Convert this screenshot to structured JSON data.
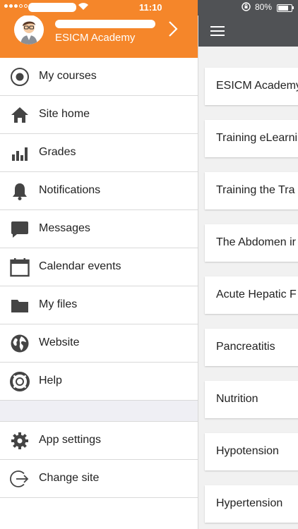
{
  "status": {
    "time": "11:10",
    "battery": "80%",
    "battery_level": 0.8
  },
  "drawer": {
    "site_name": "ESICM Academy",
    "items": [
      {
        "label": "My courses"
      },
      {
        "label": "Site home"
      },
      {
        "label": "Grades"
      },
      {
        "label": "Notifications"
      },
      {
        "label": "Messages"
      },
      {
        "label": "Calendar events"
      },
      {
        "label": "My files"
      },
      {
        "label": "Website"
      },
      {
        "label": "Help"
      }
    ],
    "bottom_items": [
      {
        "label": "App settings"
      },
      {
        "label": "Change site"
      }
    ]
  },
  "courses": [
    {
      "label": "ESICM Academy"
    },
    {
      "label": "Training eLearni"
    },
    {
      "label": "Training the Tra"
    },
    {
      "label": "The Abdomen ir"
    },
    {
      "label": "Acute Hepatic F"
    },
    {
      "label": "Pancreatitis"
    },
    {
      "label": "Nutrition"
    },
    {
      "label": "Hypotension"
    },
    {
      "label": "Hypertension"
    }
  ],
  "icons": {
    "my_courses": "target-icon",
    "site_home": "home-icon",
    "grades": "bar-chart-icon",
    "notifications": "bell-icon",
    "messages": "chat-bubble-icon",
    "calendar": "calendar-icon",
    "files": "folder-icon",
    "website": "globe-icon",
    "help": "lifebuoy-icon",
    "settings": "gear-icon",
    "change_site": "exit-icon"
  },
  "colors": {
    "brand": "#f5862a",
    "header_dark": "#505255"
  }
}
